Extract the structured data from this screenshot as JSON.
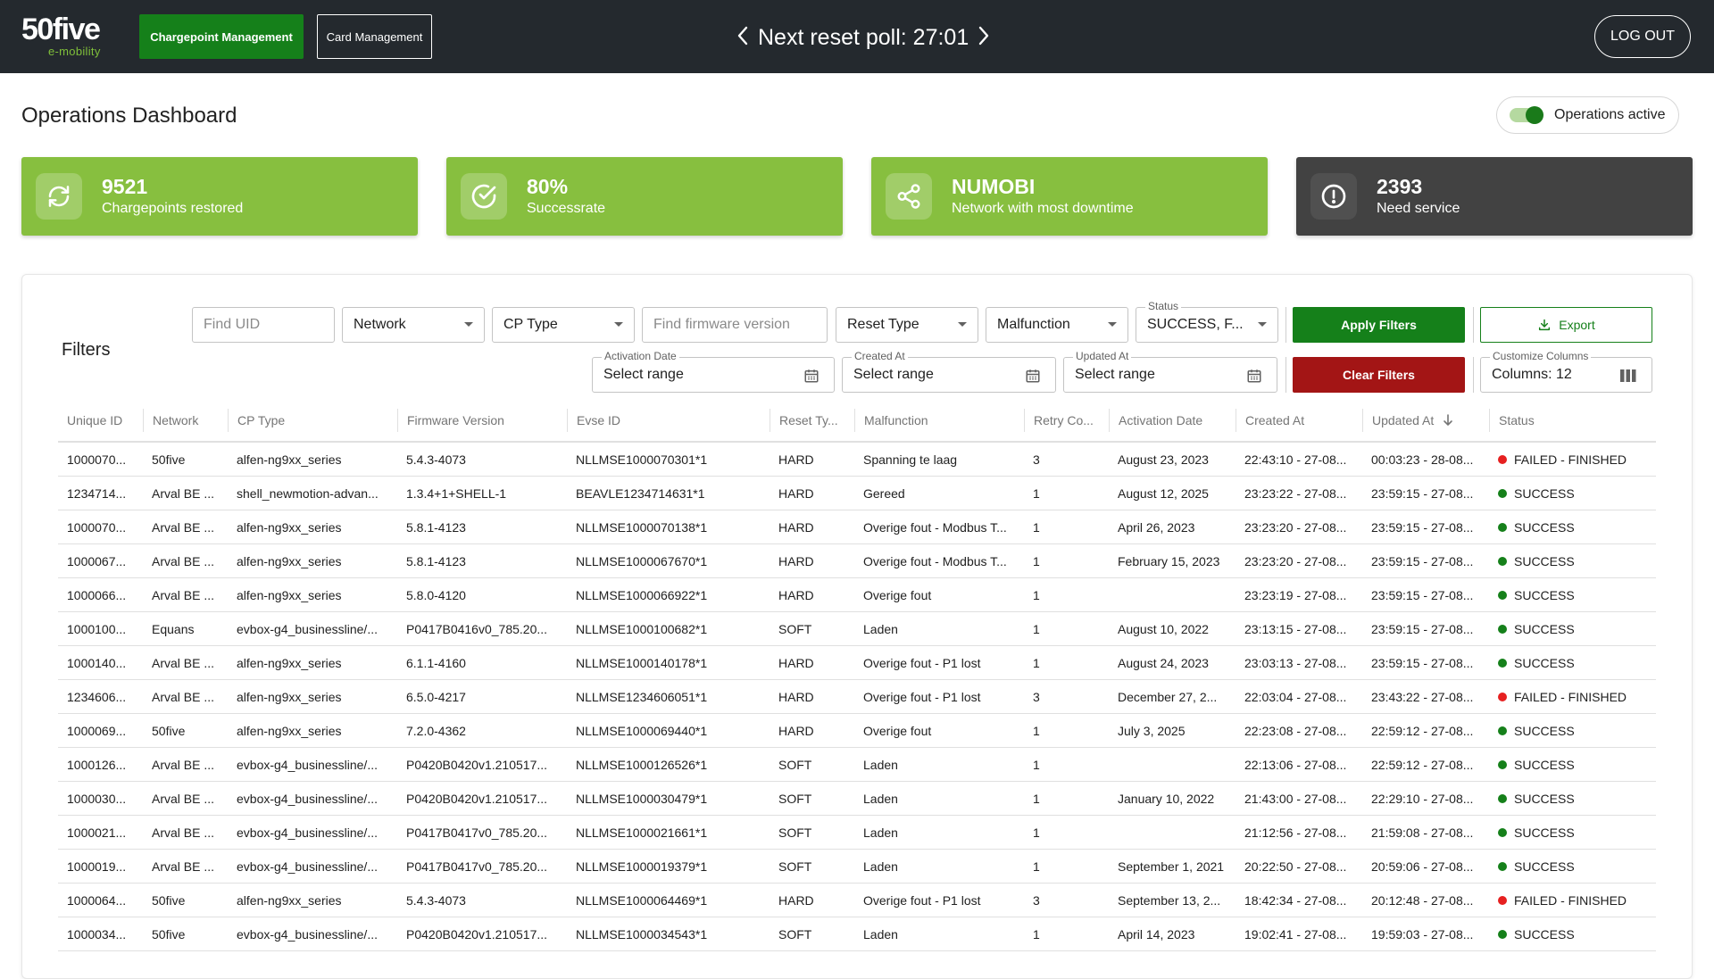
{
  "header": {
    "logo_main": "50five",
    "logo_sub": "e-mobility",
    "nav": [
      {
        "label": "Chargepoint Management",
        "active": true
      },
      {
        "label": "Card Management",
        "active": false
      }
    ],
    "poll_label": "Next reset poll: 27:01",
    "logout_label": "LOG OUT"
  },
  "page": {
    "title": "Operations Dashboard",
    "operations_toggle_label": "Operations active",
    "operations_active": true
  },
  "stats": [
    {
      "value": "9521",
      "label": "Chargepoints restored",
      "icon": "refresh-icon",
      "color": "#87bf3f"
    },
    {
      "value": "80%",
      "label": "Successrate",
      "icon": "check-circle-icon",
      "color": "#87bf3f"
    },
    {
      "value": "NUMOBI",
      "label": "Network with most downtime",
      "icon": "share-icon",
      "color": "#87bf3f"
    },
    {
      "value": "2393",
      "label": "Need service",
      "icon": "alert-circle-icon",
      "color": "#424242"
    }
  ],
  "filters": {
    "title": "Filters",
    "find_uid_placeholder": "Find UID",
    "network": "Network",
    "cp_type": "CP Type",
    "firmware_placeholder": "Find firmware version",
    "reset_type": "Reset Type",
    "malfunction": "Malfunction",
    "status_label": "Status",
    "status_value": "SUCCESS, F...",
    "activation_date_label": "Activation Date",
    "activation_date_value": "Select range",
    "created_at_label": "Created At",
    "created_at_value": "Select range",
    "updated_at_label": "Updated At",
    "updated_at_value": "Select range",
    "customize_columns_label": "Customize Columns",
    "customize_columns_value": "Columns: 12",
    "apply_label": "Apply Filters",
    "export_label": "Export",
    "clear_label": "Clear Filters"
  },
  "table": {
    "columns": [
      "Unique ID",
      "Network",
      "CP Type",
      "Firmware Version",
      "Evse ID",
      "Reset Ty...",
      "Malfunction",
      "Retry Co...",
      "Activation Date",
      "Created At",
      "Updated At",
      "Status"
    ],
    "status_colors": {
      "success": "#15801a",
      "failed": "#e62020"
    },
    "rows": [
      [
        "1000070...",
        "50five",
        "alfen-ng9xx_series",
        "5.4.3-4073",
        "NLLMSE1000070301*1",
        "HARD",
        "Spanning te laag",
        "3",
        "August 23, 2023",
        "22:43:10 - 27-08...",
        "00:03:23 - 28-08...",
        "FAILED - FINISHED"
      ],
      [
        "1234714...",
        "Arval BE ...",
        "shell_newmotion-advan...",
        "1.3.4+1+SHELL-1",
        "BEAVLE1234714631*1",
        "HARD",
        "Gereed",
        "1",
        "August 12, 2025",
        "23:23:22 - 27-08...",
        "23:59:15 - 27-08...",
        "SUCCESS"
      ],
      [
        "1000070...",
        "Arval BE ...",
        "alfen-ng9xx_series",
        "5.8.1-4123",
        "NLLMSE1000070138*1",
        "HARD",
        "Overige fout - Modbus T...",
        "1",
        "April 26, 2023",
        "23:23:20 - 27-08...",
        "23:59:15 - 27-08...",
        "SUCCESS"
      ],
      [
        "1000067...",
        "Arval BE ...",
        "alfen-ng9xx_series",
        "5.8.1-4123",
        "NLLMSE1000067670*1",
        "HARD",
        "Overige fout - Modbus T...",
        "1",
        "February 15, 2023",
        "23:23:20 - 27-08...",
        "23:59:15 - 27-08...",
        "SUCCESS"
      ],
      [
        "1000066...",
        "Arval BE ...",
        "alfen-ng9xx_series",
        "5.8.0-4120",
        "NLLMSE1000066922*1",
        "HARD",
        "Overige fout",
        "1",
        "",
        "23:23:19 - 27-08...",
        "23:59:15 - 27-08...",
        "SUCCESS"
      ],
      [
        "1000100...",
        "Equans",
        "evbox-g4_businessline/...",
        "P0417B0416v0_785.20...",
        "NLLMSE1000100682*1",
        "SOFT",
        "Laden",
        "1",
        "August 10, 2022",
        "23:13:15 - 27-08...",
        "23:59:15 - 27-08...",
        "SUCCESS"
      ],
      [
        "1000140...",
        "Arval BE ...",
        "alfen-ng9xx_series",
        "6.1.1-4160",
        "NLLMSE1000140178*1",
        "HARD",
        "Overige fout - P1 lost",
        "1",
        "August 24, 2023",
        "23:03:13 - 27-08...",
        "23:59:15 - 27-08...",
        "SUCCESS"
      ],
      [
        "1234606...",
        "Arval BE ...",
        "alfen-ng9xx_series",
        "6.5.0-4217",
        "NLLMSE1234606051*1",
        "HARD",
        "Overige fout - P1 lost",
        "3",
        "December 27, 2...",
        "22:03:04 - 27-08...",
        "23:43:22 - 27-08...",
        "FAILED - FINISHED"
      ],
      [
        "1000069...",
        "50five",
        "alfen-ng9xx_series",
        "7.2.0-4362",
        "NLLMSE1000069440*1",
        "HARD",
        "Overige fout",
        "1",
        "July 3, 2025",
        "22:23:08 - 27-08...",
        "22:59:12 - 27-08...",
        "SUCCESS"
      ],
      [
        "1000126...",
        "Arval BE ...",
        "evbox-g4_businessline/...",
        "P0420B0420v1.210517...",
        "NLLMSE1000126526*1",
        "SOFT",
        "Laden",
        "1",
        "",
        "22:13:06 - 27-08...",
        "22:59:12 - 27-08...",
        "SUCCESS"
      ],
      [
        "1000030...",
        "Arval BE ...",
        "evbox-g4_businessline/...",
        "P0420B0420v1.210517...",
        "NLLMSE1000030479*1",
        "SOFT",
        "Laden",
        "1",
        "January 10, 2022",
        "21:43:00 - 27-08...",
        "22:29:10 - 27-08...",
        "SUCCESS"
      ],
      [
        "1000021...",
        "Arval BE ...",
        "evbox-g4_businessline/...",
        "P0417B0417v0_785.20...",
        "NLLMSE1000021661*1",
        "SOFT",
        "Laden",
        "1",
        "",
        "21:12:56 - 27-08...",
        "21:59:08 - 27-08...",
        "SUCCESS"
      ],
      [
        "1000019...",
        "Arval BE ...",
        "evbox-g4_businessline/...",
        "P0417B0417v0_785.20...",
        "NLLMSE1000019379*1",
        "SOFT",
        "Laden",
        "1",
        "September 1, 2021",
        "20:22:50 - 27-08...",
        "20:59:06 - 27-08...",
        "SUCCESS"
      ],
      [
        "1000064...",
        "50five",
        "alfen-ng9xx_series",
        "5.4.3-4073",
        "NLLMSE1000064469*1",
        "HARD",
        "Overige fout - P1 lost",
        "3",
        "September 13, 2...",
        "18:42:34 - 27-08...",
        "20:12:48 - 27-08...",
        "FAILED - FINISHED"
      ],
      [
        "1000034...",
        "50five",
        "evbox-g4_businessline/...",
        "P0420B0420v1.210517...",
        "NLLMSE1000034543*1",
        "SOFT",
        "Laden",
        "1",
        "April 14, 2023",
        "19:02:41 - 27-08...",
        "19:59:03 - 27-08...",
        "SUCCESS"
      ]
    ]
  }
}
